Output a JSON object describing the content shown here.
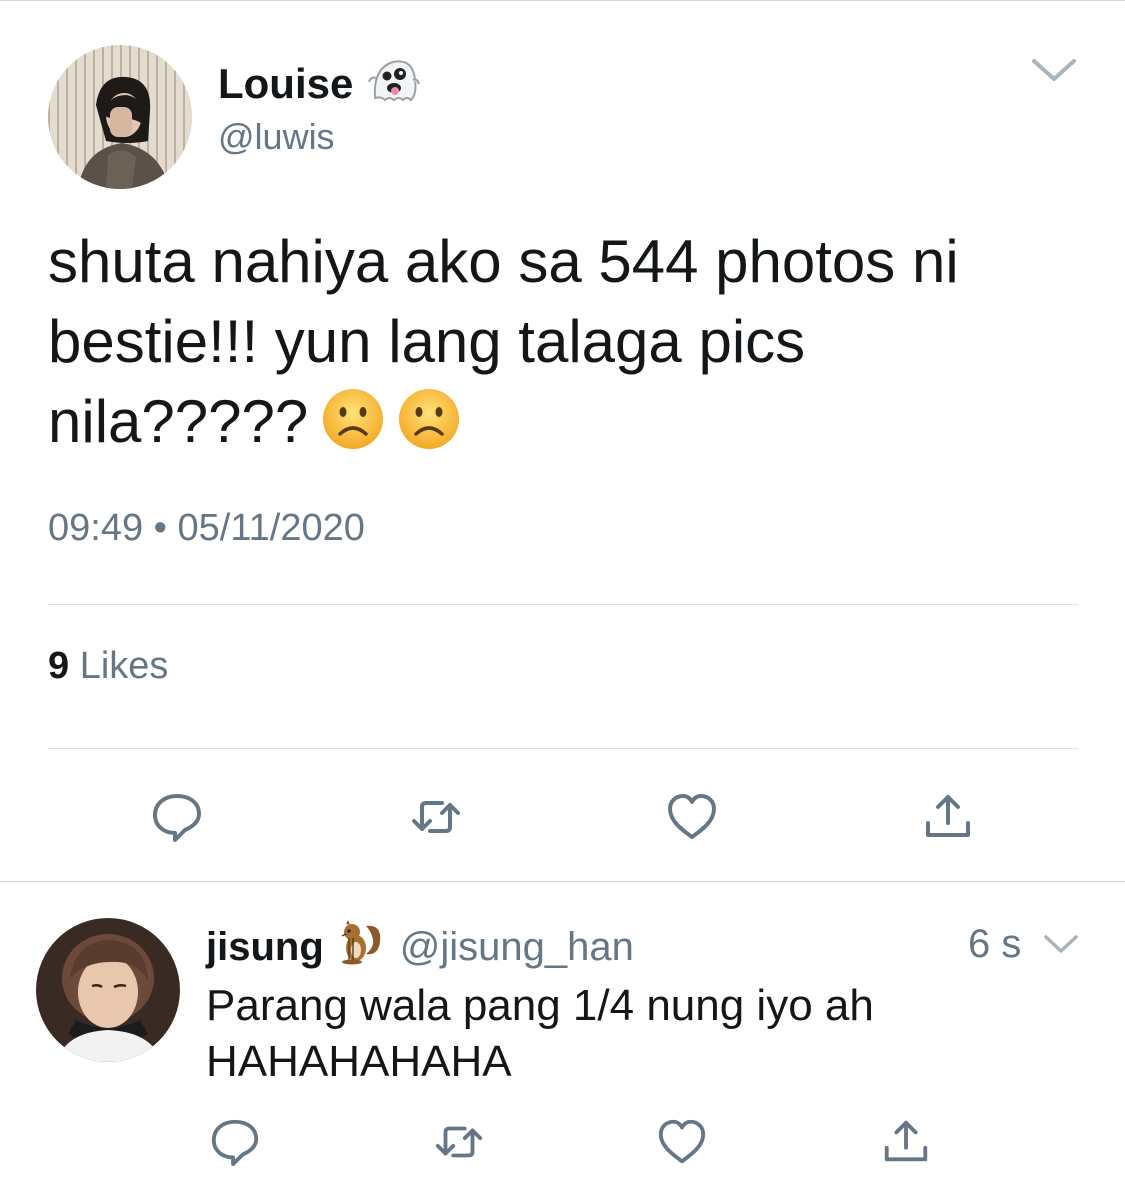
{
  "main_tweet": {
    "display_name": "Louise",
    "name_emoji": "ghost",
    "handle": "@luwis",
    "text": "shuta nahiya ako sa 544 photos ni\nbestie!!! yun lang talaga pics\nnila?????",
    "text_emojis": [
      "frowning-face",
      "frowning-face"
    ],
    "timestamp": "09:49 • 05/11/2020",
    "likes_count": "9",
    "likes_label": "Likes",
    "actions": [
      "reply-icon",
      "retweet-icon",
      "like-icon",
      "share-icon"
    ]
  },
  "reply": {
    "display_name": "jisung",
    "name_emoji": "chipmunk",
    "handle": "@jisung_han",
    "time": "6 s",
    "text": "Parang wala pang 1/4 nung iyo ah HAHAHAHAHA",
    "actions": [
      "reply-icon",
      "retweet-icon",
      "like-icon",
      "share-icon"
    ]
  },
  "colors": {
    "text_primary": "#14171a",
    "text_secondary": "#657786",
    "divider": "#dfe4e8",
    "icon": "#657786"
  }
}
